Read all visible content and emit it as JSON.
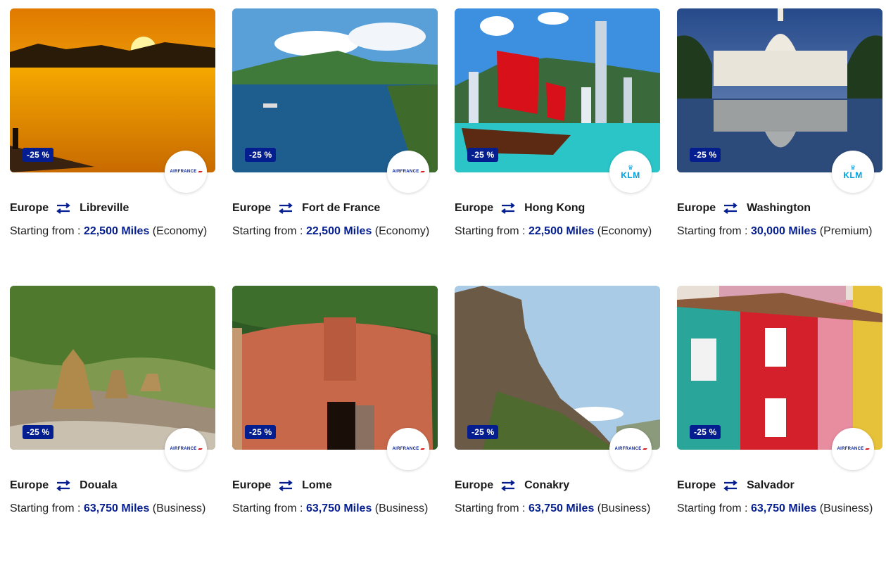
{
  "offers": [
    {
      "origin": "Europe",
      "destination": "Libreville",
      "prefix": "Starting from :",
      "miles": "22,500 Miles",
      "cabin": "(Economy)",
      "discount": "-25 %",
      "airline": "AIRFRANCE",
      "scene": "sunset-lake"
    },
    {
      "origin": "Europe",
      "destination": "Fort de France",
      "prefix": "Starting from :",
      "miles": "22,500 Miles",
      "cabin": "(Economy)",
      "discount": "-25 %",
      "airline": "AIRFRANCE",
      "scene": "bay-mountain"
    },
    {
      "origin": "Europe",
      "destination": "Hong Kong",
      "prefix": "Starting from :",
      "miles": "22,500 Miles",
      "cabin": "(Economy)",
      "discount": "-25 %",
      "airline": "KLM",
      "scene": "harbor-junk"
    },
    {
      "origin": "Europe",
      "destination": "Washington",
      "prefix": "Starting from :",
      "miles": "30,000 Miles",
      "cabin": "(Premium)",
      "discount": "-25 %",
      "airline": "KLM",
      "scene": "capitol-reflection"
    },
    {
      "origin": "Europe",
      "destination": "Douala",
      "prefix": "Starting from :",
      "miles": "63,750 Miles",
      "cabin": "(Business)",
      "discount": "-25 %",
      "airline": "AIRFRANCE",
      "scene": "straw-huts"
    },
    {
      "origin": "Europe",
      "destination": "Lome",
      "prefix": "Starting from :",
      "miles": "63,750 Miles",
      "cabin": "(Business)",
      "discount": "-25 %",
      "airline": "AIRFRANCE",
      "scene": "clay-house"
    },
    {
      "origin": "Europe",
      "destination": "Conakry",
      "prefix": "Starting from :",
      "miles": "63,750 Miles",
      "cabin": "(Business)",
      "discount": "-25 %",
      "airline": "AIRFRANCE",
      "scene": "cliff-rock"
    },
    {
      "origin": "Europe",
      "destination": "Salvador",
      "prefix": "Starting from :",
      "miles": "63,750 Miles",
      "cabin": "(Business)",
      "discount": "-25 %",
      "airline": "AIRFRANCE",
      "scene": "colonial-houses"
    }
  ],
  "colors": {
    "brand": "#051E8F",
    "klm": "#00A1DE",
    "airfrance_red": "#D71921"
  },
  "icons": {
    "route": "swap-arrows-icon"
  }
}
